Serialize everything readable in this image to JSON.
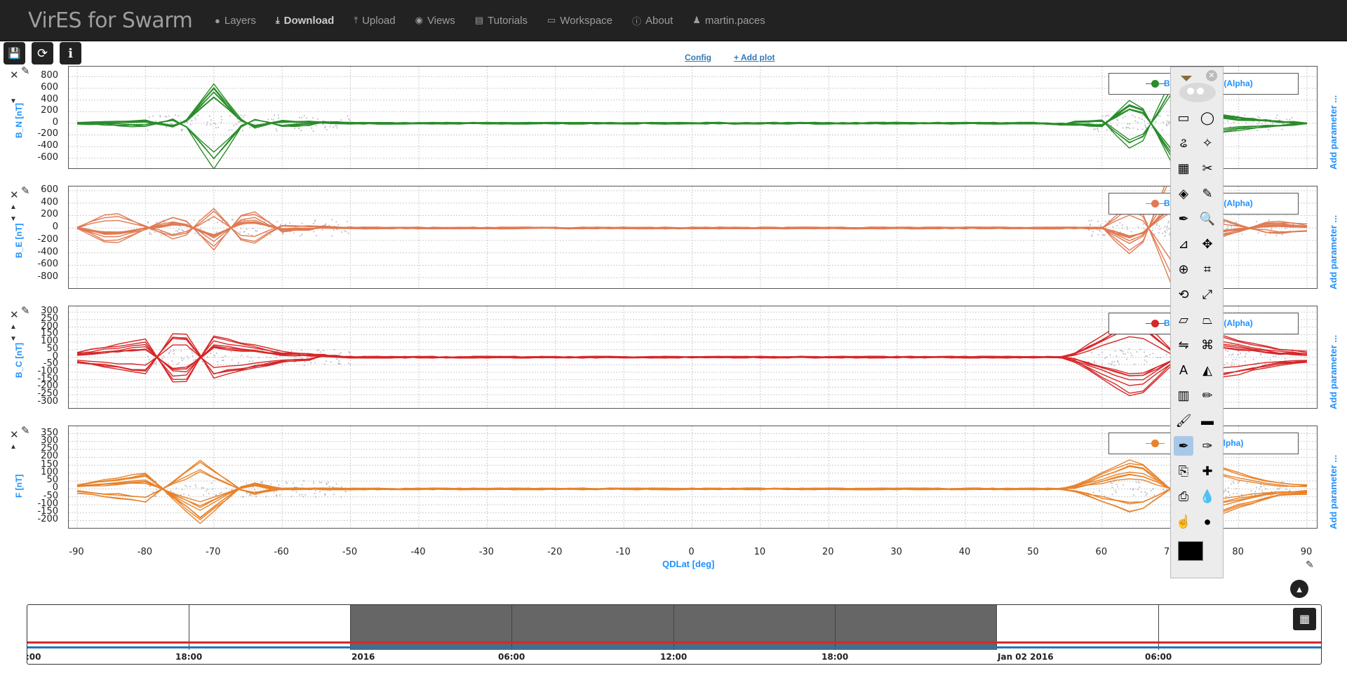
{
  "navbar": {
    "brand": "VirES for Swarm",
    "items": [
      {
        "label": "Layers",
        "icon": "globe-icon",
        "glyph": "●"
      },
      {
        "label": "Download",
        "icon": "download-icon",
        "glyph": "⤓"
      },
      {
        "label": "Upload",
        "icon": "upload-icon",
        "glyph": "⤒"
      },
      {
        "label": "Views",
        "icon": "eye-icon",
        "glyph": "◉"
      },
      {
        "label": "Tutorials",
        "icon": "book-icon",
        "glyph": "▤"
      },
      {
        "label": "Workspace",
        "icon": "laptop-icon",
        "glyph": "▭"
      },
      {
        "label": "About",
        "icon": "info-circle-icon",
        "glyph": "ⓘ"
      },
      {
        "label": "martin.paces",
        "icon": "user-icon",
        "glyph": "♟"
      }
    ]
  },
  "toolbar": {
    "save_glyph": "💾",
    "refresh_glyph": "⟳",
    "info_glyph": "i"
  },
  "plot_links": {
    "config": "Config",
    "add_plot": "+ Add plot"
  },
  "plots": [
    {
      "ylabel": "B_N [nT]",
      "ticks": [
        "800",
        "600",
        "400",
        "200",
        "0",
        "-200",
        "-400",
        "-600"
      ],
      "ylim": [
        -700,
        900
      ],
      "color": "#2a8c2a",
      "legend": "B_N (Swarm Alpha)",
      "legend_visible": "B_",
      "legend_suffix": "el (Alpha)"
    },
    {
      "ylabel": "B_E [nT]",
      "ticks": [
        "600",
        "400",
        "200",
        "0",
        "-200",
        "-400",
        "-600",
        "-800"
      ],
      "ylim": [
        -900,
        600
      ],
      "color": "#e07a52",
      "legend": "B_E",
      "legend_visible": "B_",
      "legend_suffix": "el (Alpha)"
    },
    {
      "ylabel": "B_C [nT]",
      "ticks": [
        "300",
        "250",
        "200",
        "150",
        "100",
        "50",
        "0",
        "-50",
        "-100",
        "-150",
        "-200",
        "-250",
        "-300"
      ],
      "ylim": [
        -310,
        310
      ],
      "color": "#d62728",
      "legend": "B_C",
      "legend_visible": "B_",
      "legend_suffix": "el (Alpha)"
    },
    {
      "ylabel": "F [nT]",
      "ticks": [
        "350",
        "300",
        "250",
        "200",
        "150",
        "100",
        "50",
        "0",
        "-50",
        "-100",
        "-150",
        "-200"
      ],
      "ylim": [
        -220,
        370
      ],
      "color": "#e8822a",
      "legend": "F",
      "legend_visible": "",
      "legend_suffix": "(Alpha)"
    }
  ],
  "add_parameter": "Add parameter ...",
  "xaxis": {
    "ticks": [
      "-90",
      "-80",
      "-70",
      "-60",
      "-50",
      "-40",
      "-30",
      "-20",
      "-10",
      "0",
      "10",
      "20",
      "30",
      "40",
      "50",
      "60",
      "70",
      "80",
      "90"
    ],
    "label": "QDLat [deg]"
  },
  "controls": {
    "close": "✕",
    "up": "▲",
    "down": "▼",
    "edit": "✎"
  },
  "timeline": {
    "labels": [
      ":00",
      "18:00",
      "2016",
      "06:00",
      "12:00",
      "18:00",
      "Jan 02 2016",
      "06:00"
    ],
    "calendar_glyph": "▦",
    "up_glyph": "▲"
  },
  "gimp_toolbox": {
    "tools": [
      "rect-select-icon",
      "ellipse-select-icon",
      "lasso-icon",
      "fuzzy-select-icon",
      "color-select-icon",
      "scissors-icon",
      "foreground-select-icon",
      "paths-icon",
      "color-picker-icon",
      "zoom-icon",
      "measure-icon",
      "move-icon",
      "align-icon",
      "crop-icon",
      "rotate-icon",
      "scale-icon",
      "shear-icon",
      "perspective-icon",
      "flip-icon",
      "cage-icon",
      "text-icon",
      "bucket-fill-icon",
      "gradient-icon",
      "pencil-icon",
      "paintbrush-icon",
      "eraser-icon",
      "airbrush-icon",
      "ink-icon",
      "clone-icon",
      "heal-icon",
      "perspective-clone-icon",
      "blur-icon",
      "smudge-icon",
      "dodge-icon"
    ],
    "glyphs": [
      "▭",
      "◯",
      "ଌ",
      "✧",
      "▦",
      "✂",
      "◈",
      "✎",
      "✒",
      "🔍",
      "⊿",
      "✥",
      "⊕",
      "⌗",
      "⟲",
      "⤢",
      "▱",
      "⏢",
      "⇋",
      "⌘",
      "A",
      "◭",
      "▥",
      "✏",
      "🖌",
      "▬",
      "✒",
      "✑",
      "⎘",
      "✚",
      "⎙",
      "💧",
      "☝",
      "●"
    ],
    "selected_index": 26
  },
  "chart_data": [
    {
      "type": "scatter",
      "title": "",
      "xlabel": "QDLat [deg]",
      "ylabel": "B_N [nT]",
      "xlim": [
        -90,
        90
      ],
      "ylim": [
        -700,
        900
      ],
      "series": [
        {
          "name": "B_N",
          "values": [
            [
              -90,
              0
            ],
            [
              -80,
              50
            ],
            [
              -75,
              -100
            ],
            [
              -70,
              700
            ],
            [
              -65,
              -100
            ],
            [
              -60,
              50
            ],
            [
              -50,
              0
            ],
            [
              0,
              0
            ],
            [
              50,
              0
            ],
            [
              60,
              -50
            ],
            [
              65,
              500
            ],
            [
              70,
              -650
            ],
            [
              75,
              200
            ],
            [
              80,
              100
            ],
            [
              90,
              0
            ]
          ]
        }
      ]
    },
    {
      "type": "scatter",
      "title": "",
      "xlabel": "QDLat [deg]",
      "ylabel": "B_E [nT]",
      "xlim": [
        -90,
        90
      ],
      "ylim": [
        -900,
        600
      ],
      "series": [
        {
          "name": "B_E",
          "values": [
            [
              -90,
              0
            ],
            [
              -85,
              250
            ],
            [
              -75,
              -200
            ],
            [
              -70,
              300
            ],
            [
              -65,
              -300
            ],
            [
              -60,
              50
            ],
            [
              -50,
              0
            ],
            [
              0,
              0
            ],
            [
              60,
              0
            ],
            [
              65,
              450
            ],
            [
              70,
              -800
            ],
            [
              75,
              200
            ],
            [
              85,
              -100
            ],
            [
              90,
              -50
            ]
          ]
        }
      ]
    },
    {
      "type": "scatter",
      "title": "",
      "xlabel": "QDLat [deg]",
      "ylabel": "B_C [nT]",
      "xlim": [
        -90,
        90
      ],
      "ylim": [
        -310,
        310
      ],
      "series": [
        {
          "name": "B_C",
          "values": [
            [
              -90,
              30
            ],
            [
              -80,
              100
            ],
            [
              -75,
              -200
            ],
            [
              -70,
              120
            ],
            [
              -60,
              30
            ],
            [
              -50,
              0
            ],
            [
              0,
              0
            ],
            [
              55,
              0
            ],
            [
              65,
              -250
            ],
            [
              75,
              150
            ],
            [
              85,
              50
            ],
            [
              90,
              30
            ]
          ]
        }
      ]
    },
    {
      "type": "scatter",
      "title": "",
      "xlabel": "QDLat [deg]",
      "ylabel": "F [nT]",
      "xlim": [
        -90,
        90
      ],
      "ylim": [
        -220,
        370
      ],
      "series": [
        {
          "name": "F",
          "values": [
            [
              -90,
              -30
            ],
            [
              -80,
              -100
            ],
            [
              -72,
              220
            ],
            [
              -65,
              -50
            ],
            [
              -60,
              0
            ],
            [
              0,
              0
            ],
            [
              55,
              0
            ],
            [
              65,
              -200
            ],
            [
              75,
              200
            ],
            [
              85,
              50
            ],
            [
              90,
              30
            ]
          ]
        }
      ]
    }
  ]
}
